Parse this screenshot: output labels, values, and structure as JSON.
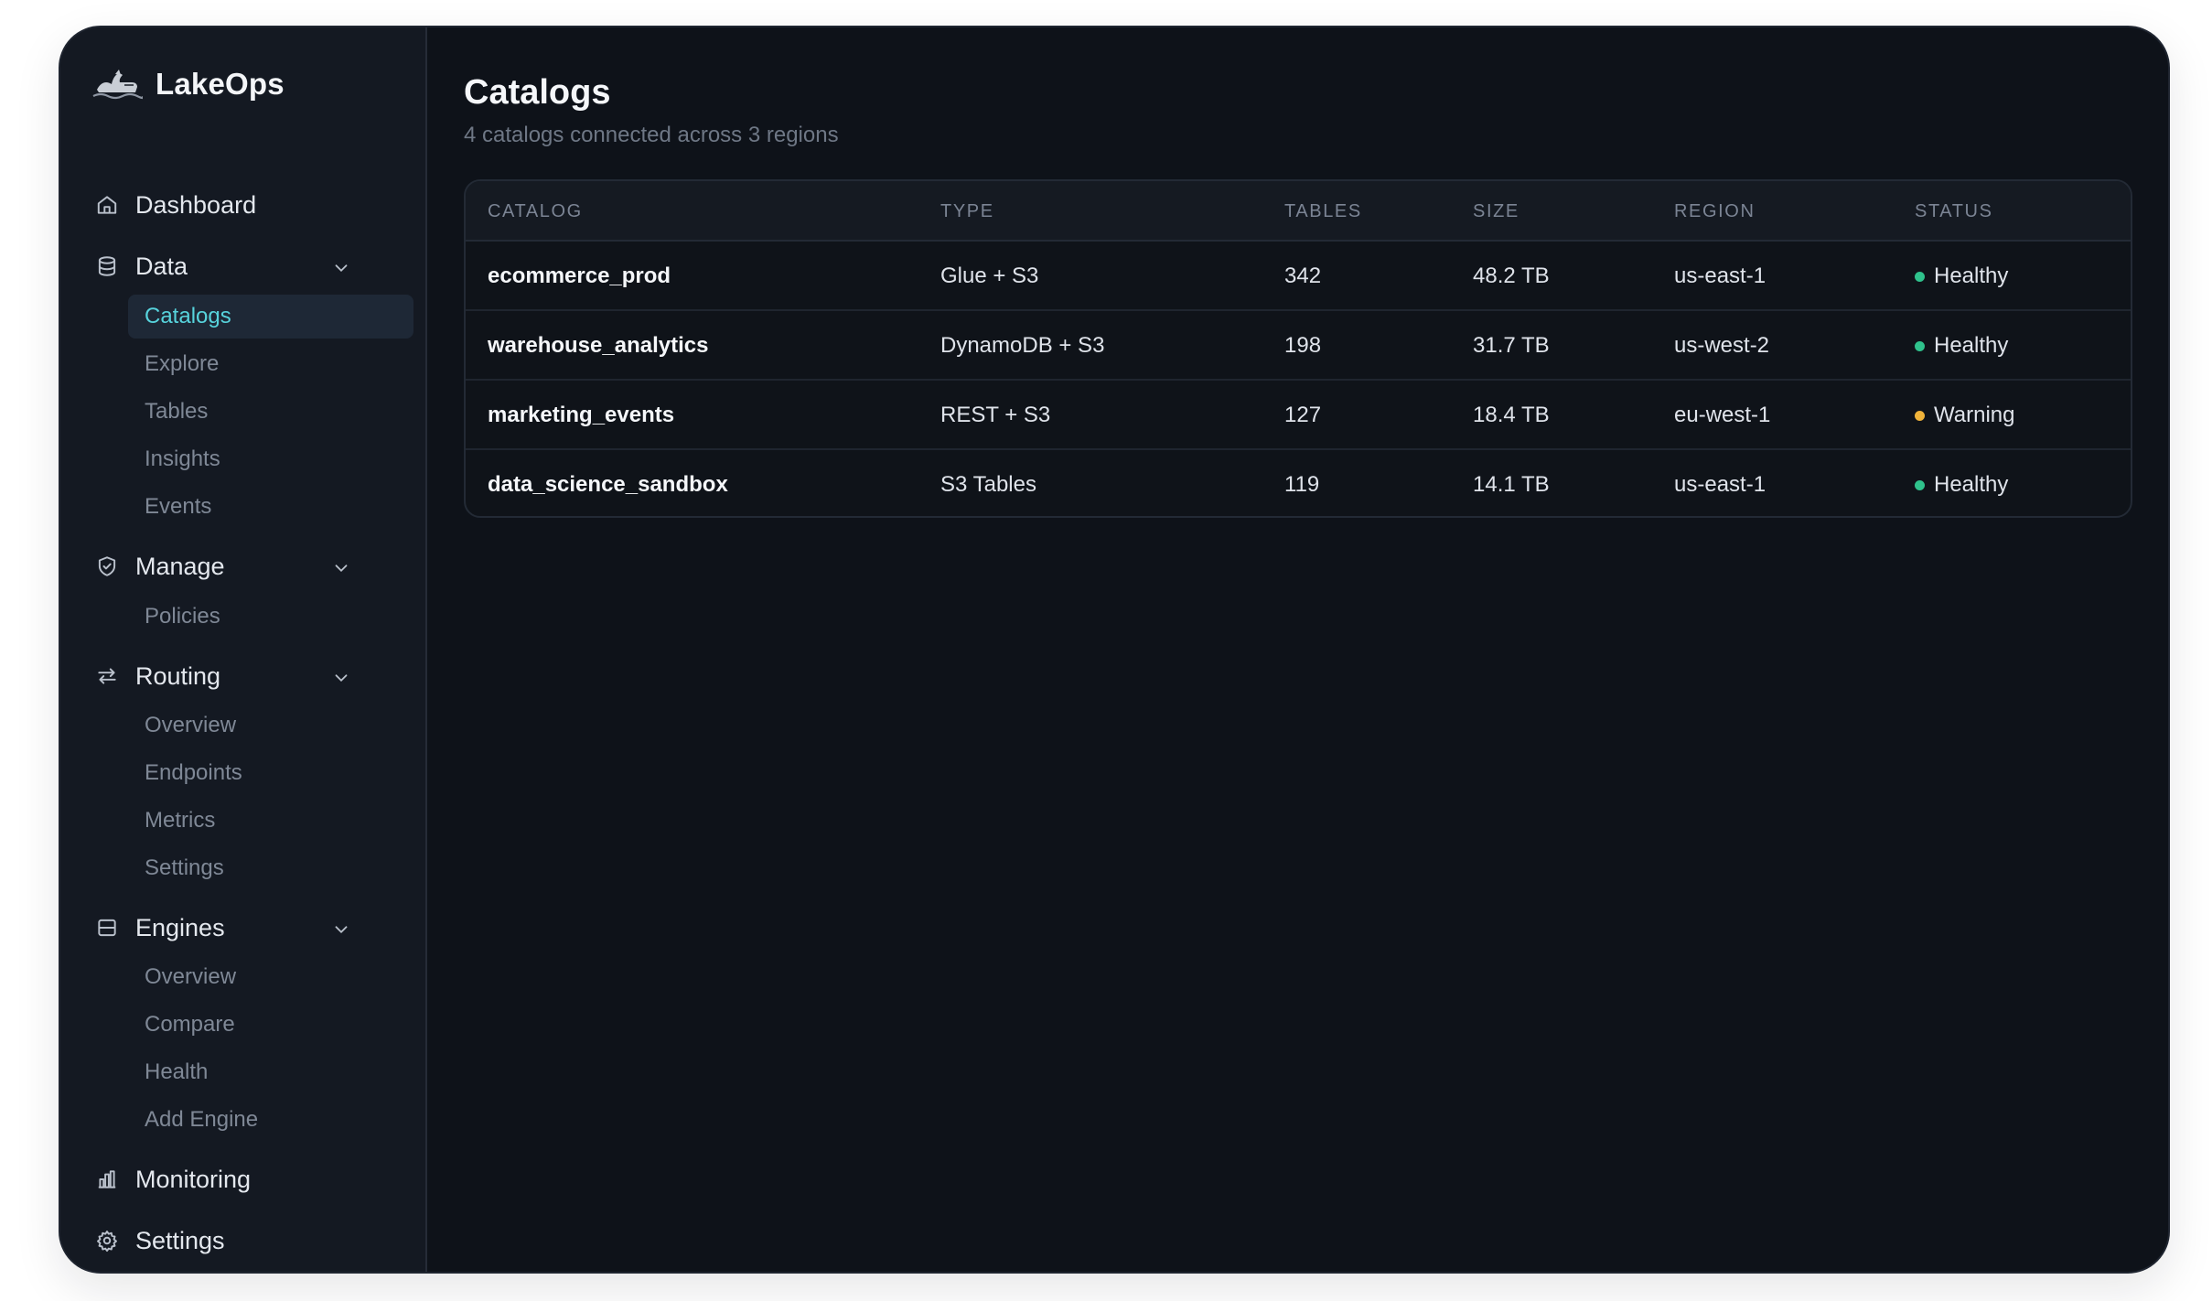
{
  "app": {
    "name": "LakeOps"
  },
  "sidebar": {
    "items": [
      {
        "label": "Dashboard",
        "icon": "home-icon",
        "expandable": false,
        "children": []
      },
      {
        "label": "Data",
        "icon": "database-icon",
        "expandable": true,
        "children": [
          {
            "label": "Catalogs",
            "active": true
          },
          {
            "label": "Explore",
            "active": false
          },
          {
            "label": "Tables",
            "active": false
          },
          {
            "label": "Insights",
            "active": false
          },
          {
            "label": "Events",
            "active": false
          }
        ]
      },
      {
        "label": "Manage",
        "icon": "shield-icon",
        "expandable": true,
        "children": [
          {
            "label": "Policies",
            "active": false
          }
        ]
      },
      {
        "label": "Routing",
        "icon": "swap-arrows-icon",
        "expandable": true,
        "children": [
          {
            "label": "Overview",
            "active": false
          },
          {
            "label": "Endpoints",
            "active": false
          },
          {
            "label": "Metrics",
            "active": false
          },
          {
            "label": "Settings",
            "active": false
          }
        ]
      },
      {
        "label": "Engines",
        "icon": "server-icon",
        "expandable": true,
        "children": [
          {
            "label": "Overview",
            "active": false
          },
          {
            "label": "Compare",
            "active": false
          },
          {
            "label": "Health",
            "active": false
          },
          {
            "label": "Add Engine",
            "active": false
          }
        ]
      },
      {
        "label": "Monitoring",
        "icon": "bar-chart-icon",
        "expandable": false,
        "children": []
      },
      {
        "label": "Settings",
        "icon": "gear-icon",
        "expandable": false,
        "children": []
      }
    ]
  },
  "main": {
    "title": "Catalogs",
    "subtitle": "4 catalogs connected across 3 regions",
    "table": {
      "columns": [
        "CATALOG",
        "TYPE",
        "TABLES",
        "SIZE",
        "REGION",
        "STATUS"
      ],
      "rows": [
        {
          "catalog": "ecommerce_prod",
          "type": "Glue + S3",
          "tables": "342",
          "size": "48.2 TB",
          "region": "us-east-1",
          "status": "Healthy"
        },
        {
          "catalog": "warehouse_analytics",
          "type": "DynamoDB + S3",
          "tables": "198",
          "size": "31.7 TB",
          "region": "us-west-2",
          "status": "Healthy"
        },
        {
          "catalog": "marketing_events",
          "type": "REST + S3",
          "tables": "127",
          "size": "18.4 TB",
          "region": "eu-west-1",
          "status": "Warning"
        },
        {
          "catalog": "data_science_sandbox",
          "type": "S3 Tables",
          "tables": "119",
          "size": "14.1 TB",
          "region": "us-east-1",
          "status": "Healthy"
        }
      ]
    }
  },
  "colors": {
    "accent": "#57d3dc",
    "healthy": "#2fc28c",
    "warning": "#f0b33a",
    "background": "#0e1219",
    "sidebar": "#141922"
  }
}
